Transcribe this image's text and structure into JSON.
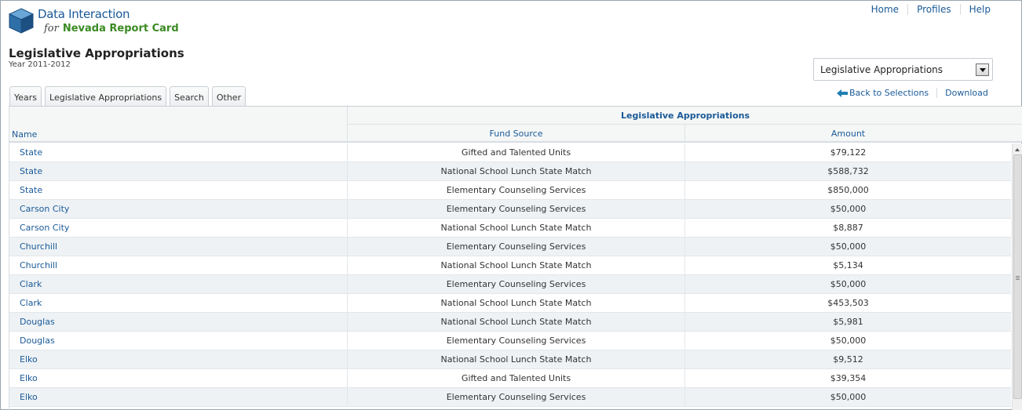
{
  "brand": {
    "line1": "Data Interaction",
    "for_word": "for",
    "line2": "Nevada Report Card"
  },
  "topnav": {
    "items": [
      "Home",
      "Profiles",
      "Help"
    ]
  },
  "page": {
    "title": "Legislative Appropriations",
    "subtitle": "Year 2011-2012"
  },
  "report_select": {
    "selected": "Legislative Appropriations"
  },
  "actions": {
    "back_label": "Back to Selections",
    "download_label": "Download"
  },
  "tabs": [
    "Years",
    "Legislative Appropriations",
    "Search",
    "Other"
  ],
  "table": {
    "group_header": "Legislative Appropriations",
    "columns": {
      "name": "Name",
      "fund_source": "Fund Source",
      "amount": "Amount"
    },
    "rows": [
      {
        "name": "State",
        "fund_source": "Gifted and Talented Units",
        "amount": "$79,122"
      },
      {
        "name": "State",
        "fund_source": "National School Lunch State Match",
        "amount": "$588,732"
      },
      {
        "name": "State",
        "fund_source": "Elementary Counseling Services",
        "amount": "$850,000"
      },
      {
        "name": "Carson City",
        "fund_source": "Elementary Counseling Services",
        "amount": "$50,000"
      },
      {
        "name": "Carson City",
        "fund_source": "National School Lunch State Match",
        "amount": "$8,887"
      },
      {
        "name": "Churchill",
        "fund_source": "Elementary Counseling Services",
        "amount": "$50,000"
      },
      {
        "name": "Churchill",
        "fund_source": "National School Lunch State Match",
        "amount": "$5,134"
      },
      {
        "name": "Clark",
        "fund_source": "Elementary Counseling Services",
        "amount": "$50,000"
      },
      {
        "name": "Clark",
        "fund_source": "National School Lunch State Match",
        "amount": "$453,503"
      },
      {
        "name": "Douglas",
        "fund_source": "National School Lunch State Match",
        "amount": "$5,981"
      },
      {
        "name": "Douglas",
        "fund_source": "Elementary Counseling Services",
        "amount": "$50,000"
      },
      {
        "name": "Elko",
        "fund_source": "National School Lunch State Match",
        "amount": "$9,512"
      },
      {
        "name": "Elko",
        "fund_source": "Gifted and Talented Units",
        "amount": "$39,354"
      },
      {
        "name": "Elko",
        "fund_source": "Elementary Counseling Services",
        "amount": "$50,000"
      }
    ]
  },
  "colors": {
    "link": "#1a5a97",
    "brand_green": "#3a8a22",
    "row_alt": "#eef2f5"
  }
}
